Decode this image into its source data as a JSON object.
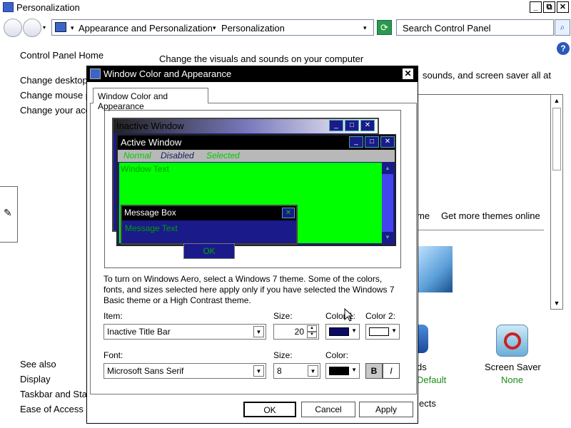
{
  "window": {
    "title": "Personalization",
    "controls": [
      "_",
      "⧉",
      "✕"
    ]
  },
  "breadcrumb": {
    "root": "Appearance and Personalization",
    "current": "Personalization"
  },
  "search": {
    "placeholder": "Search Control Panel"
  },
  "background": {
    "control_panel_home": "Control Panel Home",
    "heading": "Change the visuals and sounds on your computer",
    "subheading_fragment": "sounds, and screen saver all at",
    "left_links": [
      "Change desktop",
      "Change mouse p",
      "Change your acc"
    ],
    "see_also": "See also",
    "see_also_links": [
      "Display",
      "Taskbar and Sta",
      "Ease of Access"
    ],
    "themes_fragment": "me",
    "get_more_themes": "Get more themes online",
    "sounds_fragment": "ds",
    "sounds_value": "Default",
    "screen_saver_label": "Screen Saver",
    "screen_saver_value": "None",
    "effects_fragment": "ects"
  },
  "dialog": {
    "title": "Window Color and Appearance",
    "tab_label": "Window Color and Appearance",
    "preview": {
      "inactive_title": "Inactive Window",
      "active_title": "Active Window",
      "menu_normal": "Normal",
      "menu_disabled": "Disabled",
      "menu_selected": "Selected",
      "window_text": "Window Text",
      "msgbox_title": "Message Box",
      "msgbox_text": "Message Text",
      "msgbox_ok": "OK"
    },
    "info": "To turn on Windows Aero, select a Windows 7 theme.  Some of the colors, fonts, and sizes selected here apply only if you have selected the Windows 7 Basic theme or a High Contrast theme.",
    "item_label": "Item:",
    "item_value": "Inactive Title Bar",
    "size_label": "Size:",
    "item_size": "20",
    "color1_label": "Color 1:",
    "color2_label": "Color 2:",
    "color1_swatch": "#0a0a6a",
    "color2_swatch": "#ffffff",
    "font_label": "Font:",
    "font_value": "Microsoft Sans Serif",
    "font_size_label": "Size:",
    "font_size": "8",
    "font_color_label": "Color:",
    "font_color_swatch": "#000000",
    "bold": "B",
    "italic": "I",
    "ok": "OK",
    "cancel": "Cancel",
    "apply": "Apply"
  },
  "colors": {
    "preview_bg": "#1a1a8a",
    "window_text_bg": "#00ff00",
    "dialog_titlebar": "#000000"
  }
}
